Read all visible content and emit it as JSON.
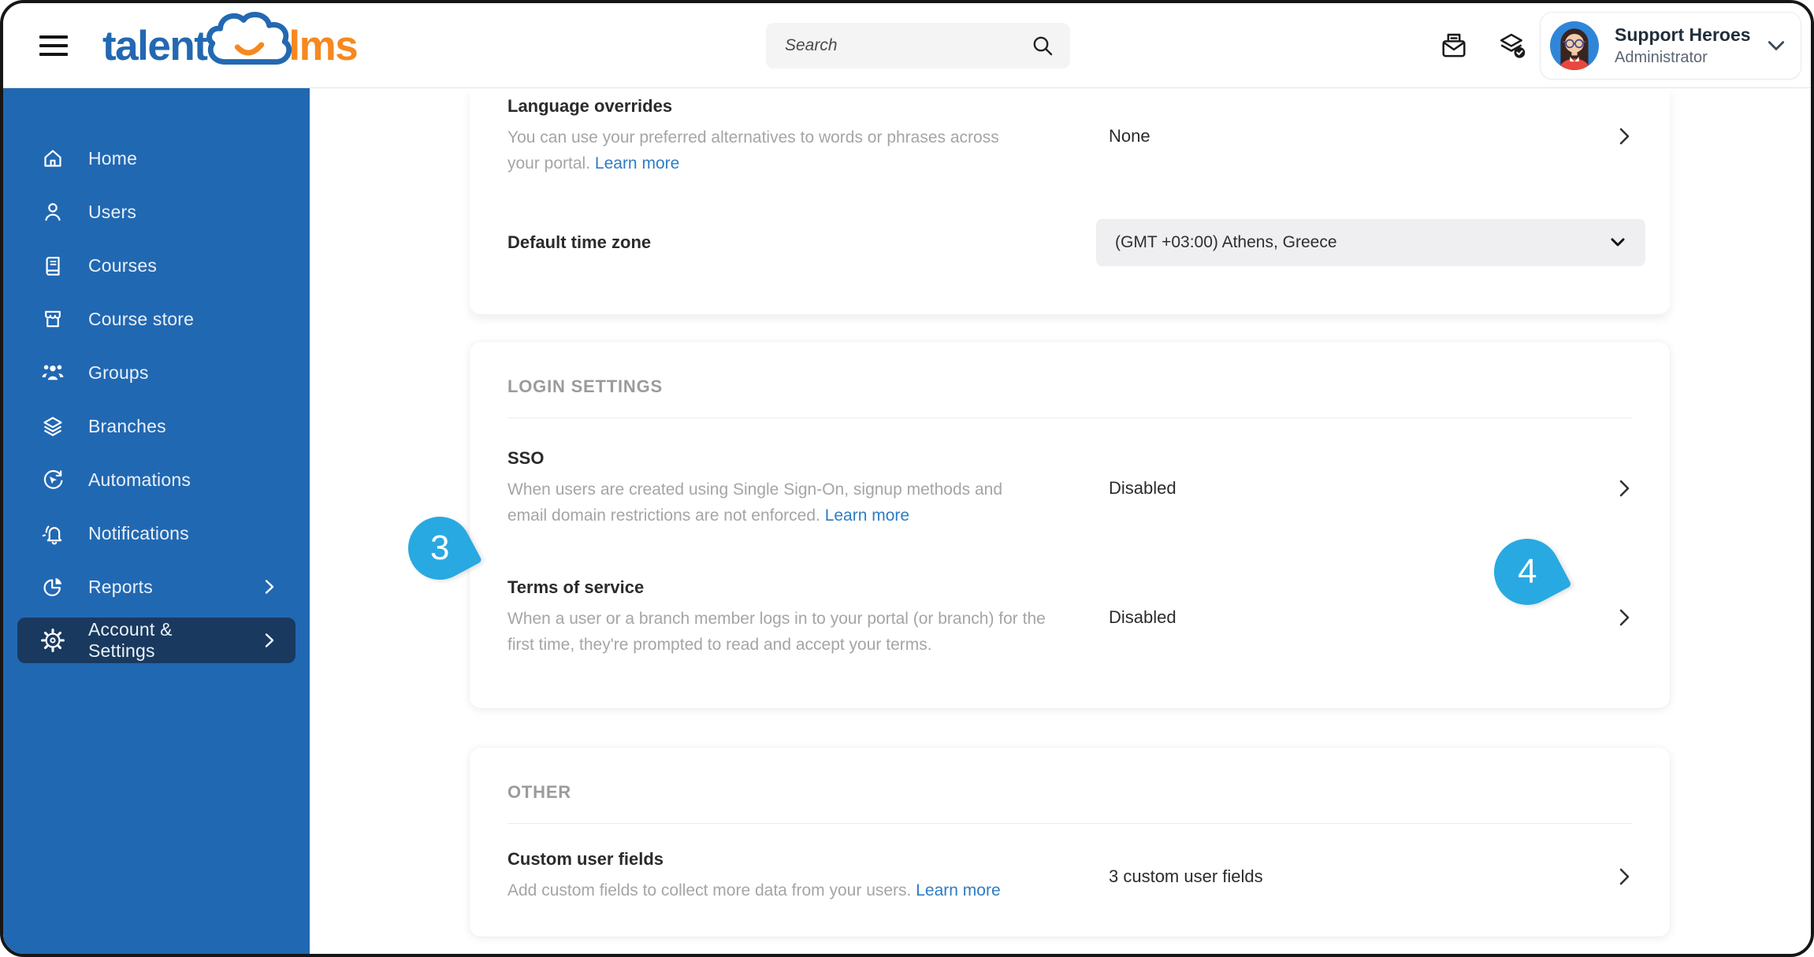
{
  "header": {
    "logo_talent": "talent",
    "logo_lms": "lms",
    "search_placeholder": "Search",
    "user_name": "Support Heroes",
    "user_role": "Administrator"
  },
  "sidebar": {
    "items": [
      {
        "label": "Home",
        "icon": "home-icon"
      },
      {
        "label": "Users",
        "icon": "user-icon"
      },
      {
        "label": "Courses",
        "icon": "book-icon"
      },
      {
        "label": "Course store",
        "icon": "store-icon"
      },
      {
        "label": "Groups",
        "icon": "groups-icon"
      },
      {
        "label": "Branches",
        "icon": "layers-icon"
      },
      {
        "label": "Automations",
        "icon": "automation-icon"
      },
      {
        "label": "Notifications",
        "icon": "bell-icon"
      },
      {
        "label": "Reports",
        "icon": "pie-chart-icon",
        "has_submenu": true
      },
      {
        "label": "Account & Settings",
        "icon": "gear-icon",
        "has_submenu": true,
        "active": true
      }
    ]
  },
  "settings": {
    "general_card": {
      "language_overrides": {
        "title": "Language overrides",
        "description": "You can use your preferred alternatives to words or phrases across your portal.",
        "link": "Learn more",
        "value": "None"
      },
      "default_time_zone": {
        "title": "Default time zone",
        "value": "(GMT +03:00) Athens, Greece"
      }
    },
    "login_card": {
      "section_title": "LOGIN SETTINGS",
      "sso": {
        "title": "SSO",
        "description": "When users are created using Single Sign-On, signup methods and email domain restrictions are not enforced.",
        "link": "Learn more",
        "value": "Disabled"
      },
      "terms": {
        "title": "Terms of service",
        "description": "When a user or a branch member logs in to your portal (or branch) for the first time, they're prompted to read and accept your terms.",
        "value": "Disabled"
      }
    },
    "other_card": {
      "section_title": "OTHER",
      "custom_user_fields": {
        "title": "Custom user fields",
        "description": "Add custom fields to collect more data from your users.",
        "link": "Learn more",
        "value": "3 custom user fields"
      }
    }
  },
  "callouts": {
    "three": "3",
    "four": "4"
  },
  "colors": {
    "sidebar_blue": "#2168B2",
    "sidebar_active": "#19395F",
    "callout_blue": "#29A9E1",
    "link_blue": "#2E7CC4",
    "logo_blue": "#2368B2",
    "logo_orange": "#F6881F"
  }
}
